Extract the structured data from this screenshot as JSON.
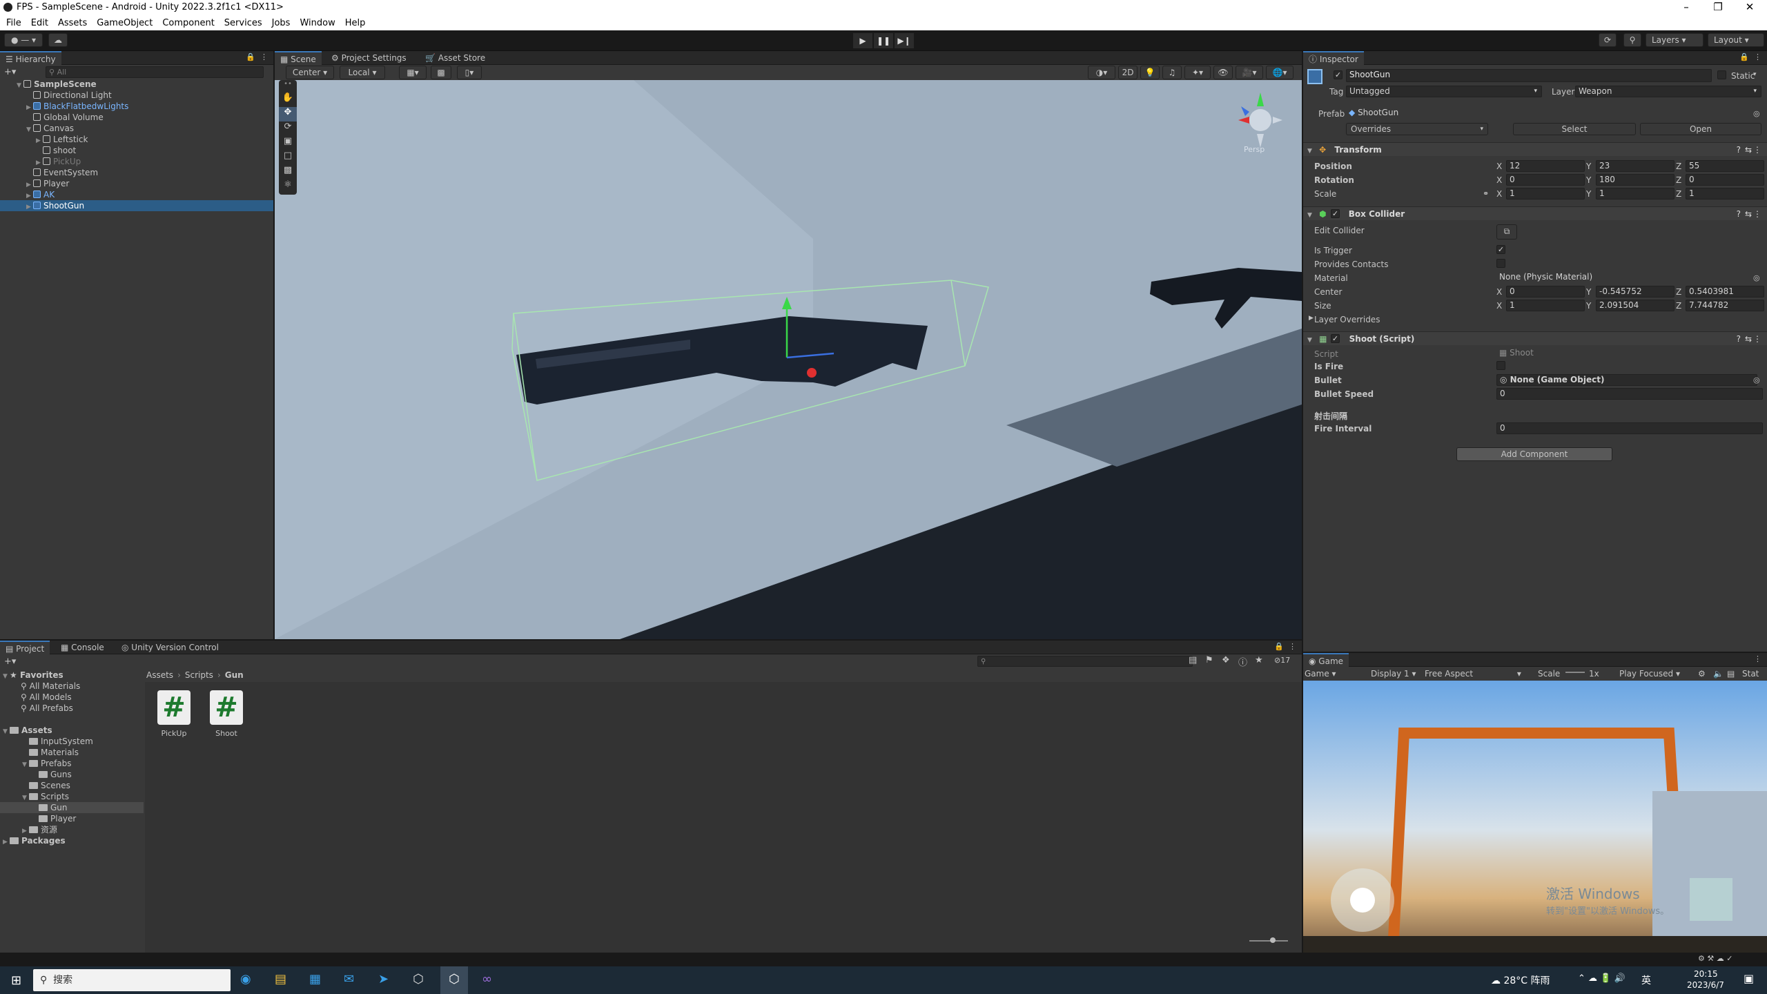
{
  "window": {
    "title": "FPS - SampleScene - Android - Unity 2022.3.2f1c1 <DX11>"
  },
  "menu": [
    "File",
    "Edit",
    "Assets",
    "GameObject",
    "Component",
    "Services",
    "Jobs",
    "Window",
    "Help"
  ],
  "toolbar": {
    "layers_label": "Layers",
    "layout_label": "Layout"
  },
  "hierarchy": {
    "tab": "Hierarchy",
    "search_placeholder": "All",
    "items": [
      {
        "label": "SampleScene",
        "indent": 0,
        "kind": "scene"
      },
      {
        "label": "Directional Light",
        "indent": 1,
        "kind": "obj"
      },
      {
        "label": "BlackFlatbedwLights",
        "indent": 1,
        "kind": "prefab"
      },
      {
        "label": "Global Volume",
        "indent": 1,
        "kind": "obj"
      },
      {
        "label": "Canvas",
        "indent": 1,
        "kind": "obj"
      },
      {
        "label": "Leftstick",
        "indent": 2,
        "kind": "obj"
      },
      {
        "label": "shoot",
        "indent": 2,
        "kind": "obj"
      },
      {
        "label": "PickUp",
        "indent": 2,
        "kind": "disabled"
      },
      {
        "label": "EventSystem",
        "indent": 1,
        "kind": "obj"
      },
      {
        "label": "Player",
        "indent": 1,
        "kind": "obj"
      },
      {
        "label": "AK",
        "indent": 1,
        "kind": "prefab"
      },
      {
        "label": "ShootGun",
        "indent": 1,
        "kind": "selected"
      }
    ]
  },
  "scene": {
    "tabs": [
      "Scene",
      "Project Settings",
      "Asset Store"
    ],
    "pivot": "Center",
    "space": "Local",
    "mode2d": "2D",
    "persp": "Persp"
  },
  "inspector": {
    "tab": "Inspector",
    "object_name": "ShootGun",
    "static_label": "Static",
    "tag_label": "Tag",
    "tag_value": "Untagged",
    "layer_label": "Layer",
    "layer_value": "Weapon",
    "prefab_label": "Prefab",
    "prefab_value": "ShootGun",
    "overrides": "Overrides",
    "select": "Select",
    "open": "Open",
    "transform": {
      "title": "Transform",
      "position_label": "Position",
      "position": [
        "12",
        "23",
        "55"
      ],
      "rotation_label": "Rotation",
      "rotation": [
        "0",
        "180",
        "0"
      ],
      "scale_label": "Scale",
      "scale": [
        "1",
        "1",
        "1"
      ]
    },
    "box_collider": {
      "title": "Box Collider",
      "edit_collider": "Edit Collider",
      "is_trigger": "Is Trigger",
      "provides_contacts": "Provides Contacts",
      "material_label": "Material",
      "material_value": "None (Physic Material)",
      "center_label": "Center",
      "center": [
        "0",
        "-0.545752",
        "0.5403981"
      ],
      "size_label": "Size",
      "size": [
        "1",
        "2.091504",
        "7.744782"
      ],
      "layer_overrides": "Layer Overrides"
    },
    "shoot_script": {
      "title": "Shoot (Script)",
      "script_label": "Script",
      "script_value": "Shoot",
      "is_fire": "Is Fire",
      "bullet_label": "Bullet",
      "bullet_value": "None (Game Object)",
      "bullet_speed_label": "Bullet Speed",
      "bullet_speed_value": "0",
      "header_cn": "射击间隔",
      "fire_interval_label": "Fire Interval",
      "fire_interval_value": "0"
    },
    "add_component": "Add Component"
  },
  "project": {
    "tabs": [
      "Project",
      "Console",
      "Unity Version Control"
    ],
    "count": "17",
    "breadcrumb": [
      "Assets",
      "Scripts",
      "Gun"
    ],
    "favorites_label": "Favorites",
    "favorites": [
      "All Materials",
      "All Models",
      "All Prefabs"
    ],
    "assets_label": "Assets",
    "tree": [
      {
        "label": "InputSystem",
        "indent": 1
      },
      {
        "label": "Materials",
        "indent": 1
      },
      {
        "label": "Prefabs",
        "indent": 1
      },
      {
        "label": "Guns",
        "indent": 2
      },
      {
        "label": "Scenes",
        "indent": 1
      },
      {
        "label": "Scripts",
        "indent": 1
      },
      {
        "label": "Gun",
        "indent": 2
      },
      {
        "label": "Player",
        "indent": 2
      },
      {
        "label": "资源",
        "indent": 1
      }
    ],
    "packages_label": "Packages",
    "files": [
      "PickUp",
      "Shoot"
    ]
  },
  "game": {
    "tab": "Game",
    "mode": "Game",
    "display": "Display 1",
    "aspect": "Free Aspect",
    "scale_label": "Scale",
    "scale_value": "1x",
    "play_focused": "Play Focused",
    "stats": "Stat",
    "watermark1": "激活 Windows",
    "watermark2": "转到\"设置\"以激活 Windows。"
  },
  "taskbar": {
    "search": "搜索",
    "weather": "28°C 阵雨",
    "ime": "英",
    "time": "20:15",
    "date": "2023/6/7"
  },
  "colors": {
    "selection": "#2c5d87",
    "prefab_text": "#7ab6ff",
    "tab_accent": "#3a79bb"
  }
}
